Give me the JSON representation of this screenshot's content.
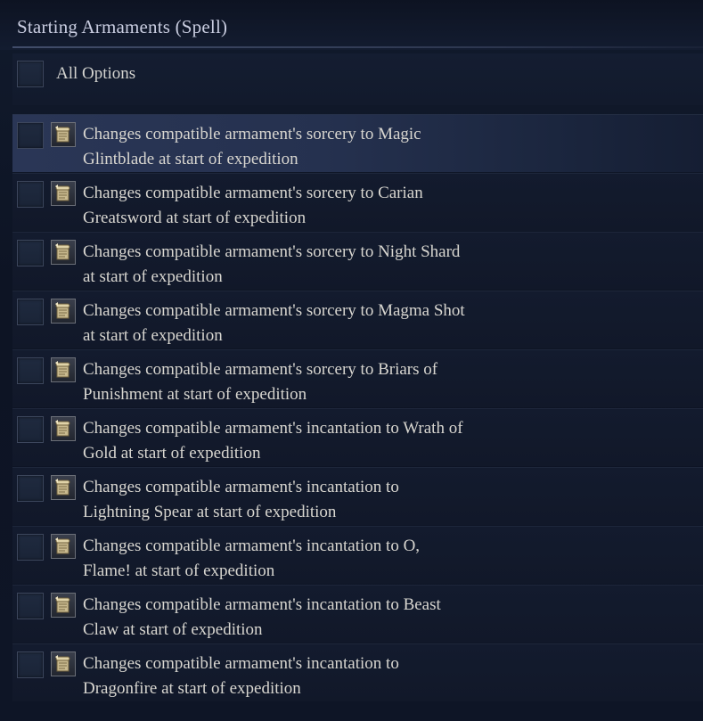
{
  "section": {
    "title": "Starting Armaments (Spell)"
  },
  "all_options": {
    "label": "All Options",
    "checked": false
  },
  "options": [
    {
      "text": "Changes compatible armament's sorcery to Magic Glintblade at start of expedition",
      "icon": "scroll-icon",
      "checked": false,
      "highlighted": true
    },
    {
      "text": "Changes compatible armament's sorcery to Carian Greatsword at start of expedition",
      "icon": "scroll-icon",
      "checked": false,
      "highlighted": false
    },
    {
      "text": "Changes compatible armament's sorcery to Night Shard at start of expedition",
      "icon": "scroll-icon",
      "checked": false,
      "highlighted": false
    },
    {
      "text": "Changes compatible armament's sorcery to Magma Shot at start of expedition",
      "icon": "scroll-icon",
      "checked": false,
      "highlighted": false
    },
    {
      "text": "Changes compatible armament's sorcery to Briars of Punishment at start of expedition",
      "icon": "scroll-icon",
      "checked": false,
      "highlighted": false
    },
    {
      "text": "Changes compatible armament's incantation to Wrath of Gold at start of expedition",
      "icon": "scroll-icon",
      "checked": false,
      "highlighted": false
    },
    {
      "text": "Changes compatible armament's incantation to Lightning Spear at start of expedition",
      "icon": "scroll-icon",
      "checked": false,
      "highlighted": false
    },
    {
      "text": "Changes compatible armament's incantation to O, Flame! at start of expedition",
      "icon": "scroll-icon",
      "checked": false,
      "highlighted": false
    },
    {
      "text": "Changes compatible armament's incantation to Beast Claw at start of expedition",
      "icon": "scroll-icon",
      "checked": false,
      "highlighted": false
    },
    {
      "text": "Changes compatible armament's incantation to Dragonfire at start of expedition",
      "icon": "scroll-icon",
      "checked": false,
      "highlighted": false
    }
  ],
  "colors": {
    "background": "#0f1626",
    "highlight": "#2a3656",
    "text": "#d8d6d0",
    "title": "#c9cde0"
  }
}
